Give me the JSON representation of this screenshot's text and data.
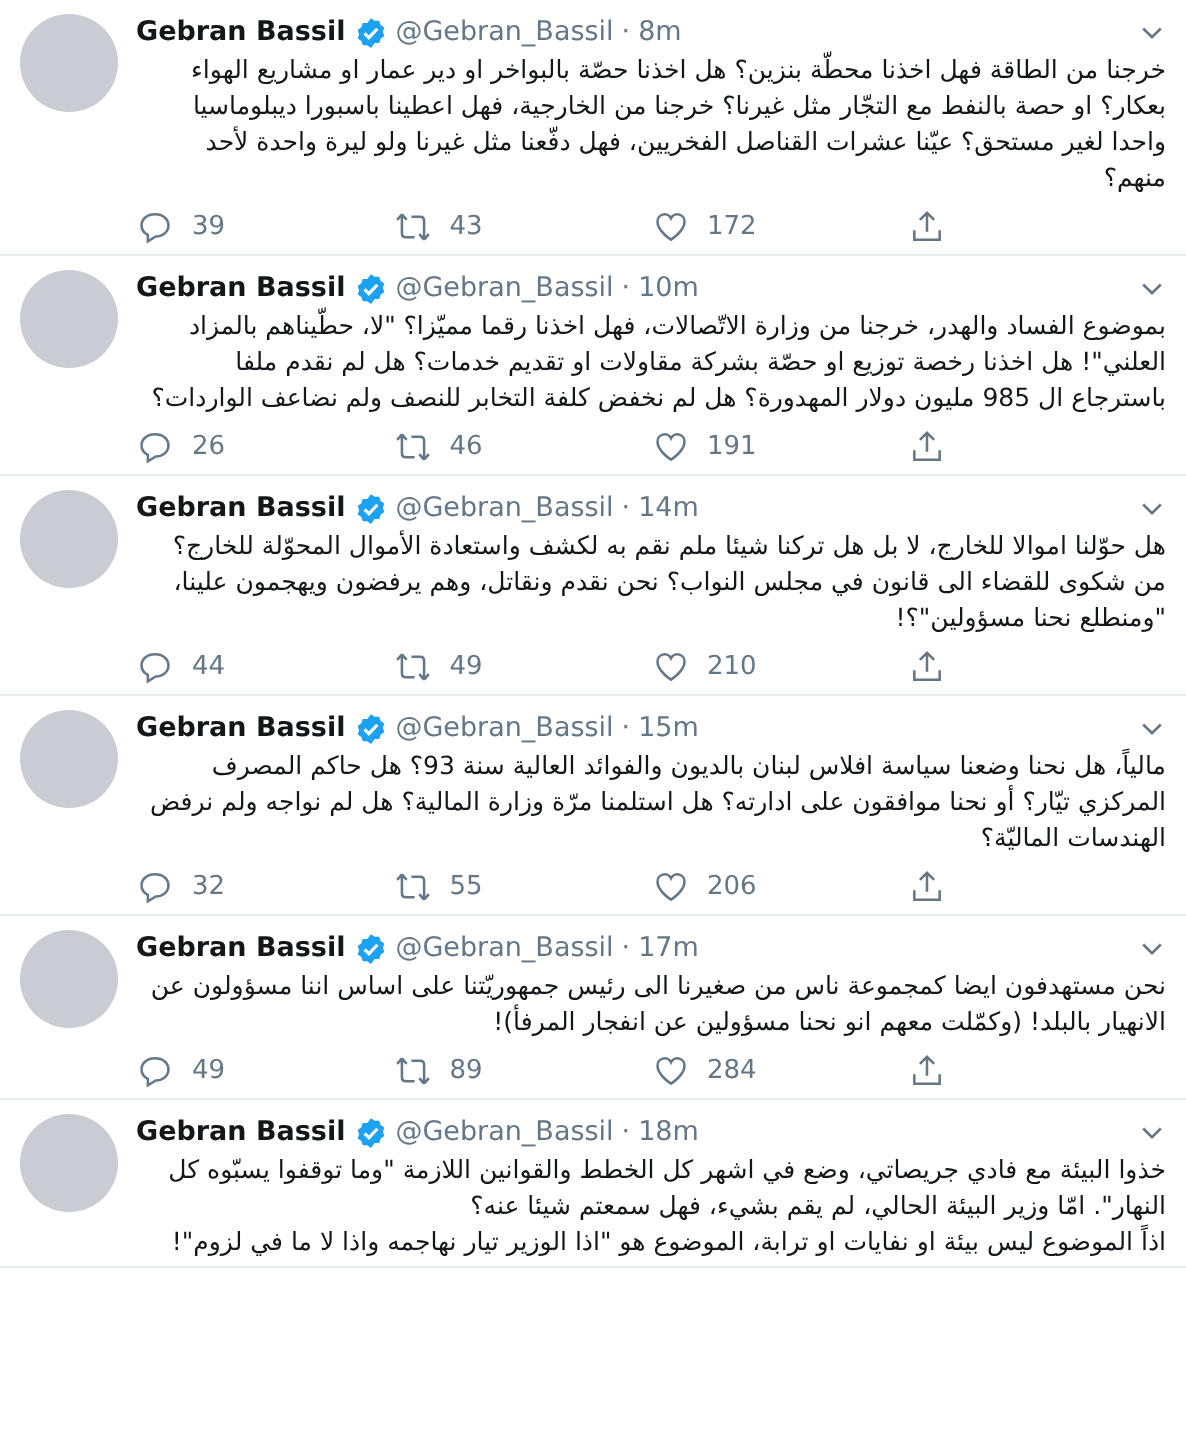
{
  "separator": "·",
  "tweets": [
    {
      "name": "Gebran Bassil",
      "verified": true,
      "handle": "@Gebran_Bassil",
      "time": "8m",
      "text": "خرجنا من الطاقة فهل اخذنا محطّة بنزين؟ هل اخذنا حصّة بالبواخر او دير عمار او مشاريع الهواء بعكار؟ او حصة بالنفط مع التجّار مثل غيرنا؟ خرجنا من الخارجية، فهل اعطينا باسبورا ديبلوماسيا واحدا لغير مستحق؟ عيّنا عشرات القناصل الفخريين، فهل دفّعنا مثل غيرنا ولو ليرة واحدة لأحد منهم؟",
      "replies": "39",
      "retweets": "43",
      "likes": "172"
    },
    {
      "name": "Gebran Bassil",
      "verified": true,
      "handle": "@Gebran_Bassil",
      "time": "10m",
      "text": "بموضوع الفساد والهدر، خرجنا من وزارة الاتّصالات، فهل اخذنا رقما مميّزا؟ \"لا، حطّيناهم بالمزاد العلني\"! هل اخذنا رخصة توزيع او حصّة بشركة مقاولات او تقديم خدمات؟ هل لم نقدم ملفا باسترجاع ال 985 مليون دولار المهدورة؟ هل لم نخفض كلفة التخابر للنصف ولم نضاعف الواردات؟",
      "replies": "26",
      "retweets": "46",
      "likes": "191"
    },
    {
      "name": "Gebran Bassil",
      "verified": true,
      "handle": "@Gebran_Bassil",
      "time": "14m",
      "text": "هل حوّلنا اموالا للخارج، لا بل هل تركنا شيئا ملم نقم به لكشف واستعادة الأموال المحوّلة للخارج؟ من شكوى للقضاء الى قانون في مجلس النواب؟ نحن نقدم ونقاتل، وهم يرفضون ويهجمون علينا، \"ومنطلع نحنا مسؤولين\"؟!",
      "replies": "44",
      "retweets": "49",
      "likes": "210"
    },
    {
      "name": "Gebran Bassil",
      "verified": true,
      "handle": "@Gebran_Bassil",
      "time": "15m",
      "text": "مالياً، هل نحنا وضعنا سياسة افلاس لبنان بالديون والفوائد العالية سنة 93؟ هل حاكم المصرف المركزي تيّار؟ أو نحنا موافقون على ادارته؟ هل استلمنا مرّة وزارة المالية؟ هل لم نواجه ولم نرفض الهندسات الماليّة؟",
      "replies": "32",
      "retweets": "55",
      "likes": "206"
    },
    {
      "name": "Gebran Bassil",
      "verified": true,
      "handle": "@Gebran_Bassil",
      "time": "17m",
      "text": "نحن مستهدفون ايضا كمجموعة ناس من صغيرنا الى رئيس جمهوريّتنا على اساس اننا مسؤولون عن الانهيار بالبلد! (وكمّلت معهم انو نحنا مسؤولين عن انفجار المرفأ)!",
      "replies": "49",
      "retweets": "89",
      "likes": "284"
    },
    {
      "name": "Gebran Bassil",
      "verified": true,
      "handle": "@Gebran_Bassil",
      "time": "18m",
      "text": "خذوا البيئة مع فادي جريصاتي، وضع في اشهر كل الخطط والقوانين اللازمة \"وما توقفوا يسبّوه كل النهار\". امّا وزير البيئة الحالي، لم يقم بشيء، فهل سمعتم شيئا عنه؟\nاذاً الموضوع ليس بيئة او نفايات او ترابة، الموضوع هو \"اذا الوزير تيار نهاجمه واذا لا ما في لزوم\"!"
    }
  ]
}
